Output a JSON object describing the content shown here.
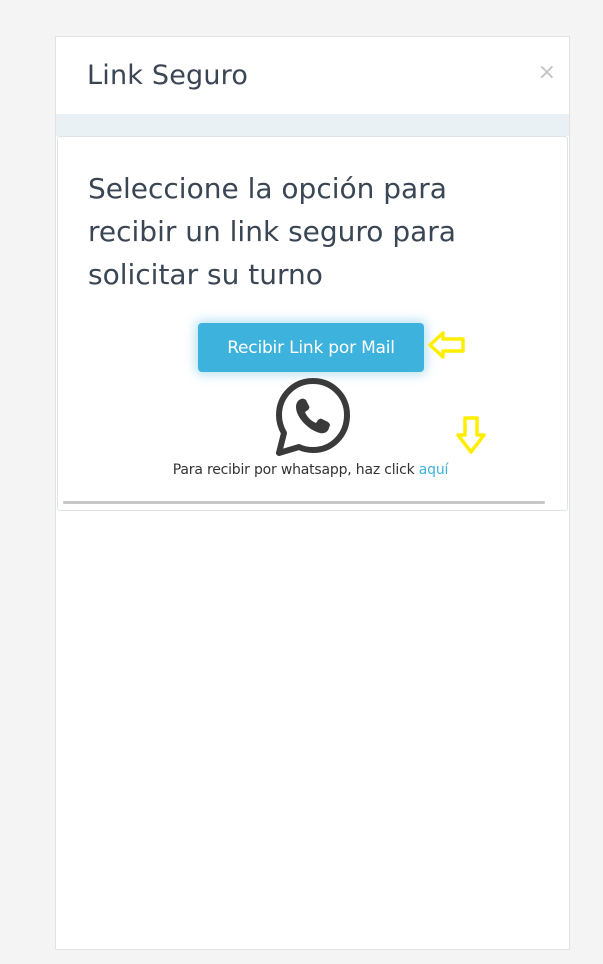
{
  "modal": {
    "title": "Link Seguro",
    "close_label": "×"
  },
  "card": {
    "heading": "Seleccione la opción para recibir un link seguro para solicitar su turno",
    "mail_button_label": "Recibir Link por Mail",
    "whatsapp_text": "Para recibir por whatsapp, haz click",
    "whatsapp_link_label": "aquí"
  },
  "icons": {
    "whatsapp": "whatsapp-icon",
    "left_arrow": "arrow-left-icon",
    "down_arrow": "arrow-down-icon"
  },
  "colors": {
    "accent": "#3cb2dc",
    "highlight_arrow": "#ffee00",
    "title_text": "#3a4654"
  }
}
